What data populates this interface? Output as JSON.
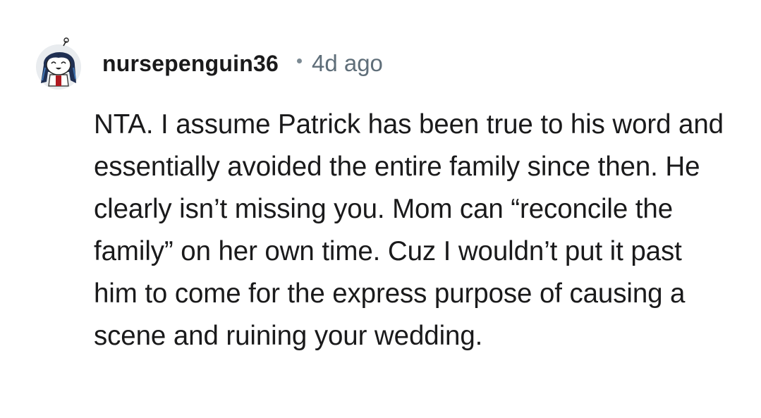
{
  "comment": {
    "author": {
      "username": "nursepenguin36",
      "avatar_icon": "snoo-avatar-icon"
    },
    "separator": "•",
    "timestamp": "4d ago",
    "body": "NTA. I assume Patrick has been true to his word and essentially avoided the entire family since then. He clearly isn’t missing you. Mom can “reconcile the family” on her own time. Cuz I wouldn’t put it past him to come for the express purpose of causing a scene and ruining your wedding."
  },
  "colors": {
    "text": "#1a1a1b",
    "meta": "#5f6e79",
    "avatar_hair": "#1f2f52",
    "avatar_accent": "#b01a22"
  }
}
